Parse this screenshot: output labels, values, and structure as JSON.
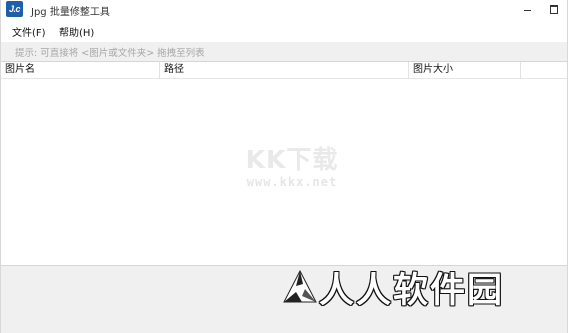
{
  "window": {
    "title": "Jpg 批量修整工具",
    "icon_label": "J.c",
    "icon_name": "app-icon",
    "accent_color": "#1f5ea8"
  },
  "menu": {
    "items": [
      {
        "label": "文件(F)"
      },
      {
        "label": "帮助(H)"
      }
    ]
  },
  "hint": {
    "text": "提示: 可直接将 <图片或文件夹> 拖拽至列表"
  },
  "table": {
    "columns": [
      {
        "label": "图片名"
      },
      {
        "label": "路径"
      },
      {
        "label": "图片大小"
      }
    ],
    "rows": []
  },
  "watermark": {
    "title": "KK下载",
    "url": "www.kkx.net"
  },
  "brand": {
    "text": "人人软件园",
    "icon_name": "triangle-logo-icon"
  }
}
